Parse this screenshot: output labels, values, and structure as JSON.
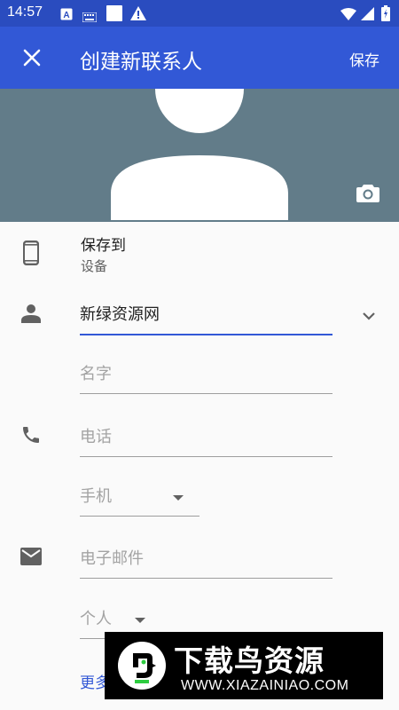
{
  "status_bar": {
    "time": "14:57",
    "icons": [
      "text-a-icon",
      "keyboard-icon",
      "square-icon",
      "warning-icon",
      "wifi-icon",
      "signal-icon",
      "battery-icon"
    ]
  },
  "app_bar": {
    "title": "创建新联系人",
    "save_label": "保存",
    "close_icon": "close-icon"
  },
  "photo": {
    "placeholder_icon": "person-silhouette",
    "camera_icon": "camera-icon"
  },
  "save_to": {
    "label": "保存到",
    "value": "设备",
    "icon": "phone-device-icon"
  },
  "name": {
    "icon": "person-icon",
    "value": "新绿资源网",
    "name_placeholder": "名字",
    "expand_icon": "chevron-down-icon"
  },
  "phone": {
    "icon": "phone-icon",
    "placeholder": "电话",
    "type": "手机"
  },
  "email": {
    "icon": "email-icon",
    "placeholder": "电子邮件",
    "type": "个人"
  },
  "more_fields": "更多",
  "watermark": {
    "title": "下载鸟资源",
    "url": "WWW.XIAZAINIAO.COM"
  },
  "colors": {
    "primary": "#3258d6",
    "status_bar": "#2a4cbf",
    "photo_bg": "#627c89",
    "background": "#fafafa"
  }
}
